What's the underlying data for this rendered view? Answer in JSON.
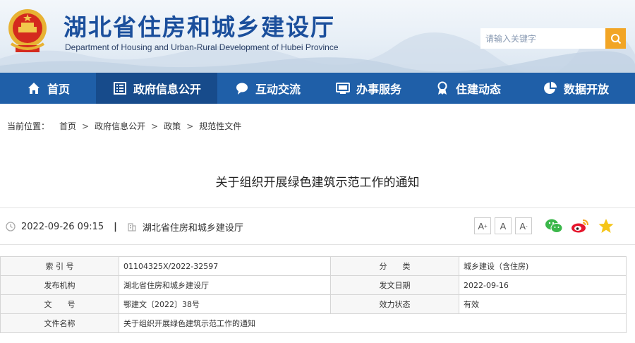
{
  "header": {
    "title": "湖北省住房和城乡建设厅",
    "subtitle": "Department of Housing and Urban-Rural Development of Hubei Province",
    "search": {
      "placeholder": "请输入关键字"
    }
  },
  "nav": {
    "items": [
      {
        "label": "首页",
        "icon": "home-icon"
      },
      {
        "label": "政府信息公开",
        "icon": "document-list-icon"
      },
      {
        "label": "互动交流",
        "icon": "speech-bubble-icon"
      },
      {
        "label": "办事服务",
        "icon": "monitor-icon"
      },
      {
        "label": "住建动态",
        "icon": "award-icon"
      },
      {
        "label": "数据开放",
        "icon": "pie-chart-icon"
      }
    ],
    "active_index": 1
  },
  "breadcrumb": {
    "label": "当前位置：",
    "items": [
      "首页",
      "政府信息公开",
      "政策",
      "规范性文件"
    ],
    "separator": ">"
  },
  "article": {
    "title": "关于组织开展绿色建筑示范工作的通知",
    "datetime": "2022-09-26 09:15",
    "source": "湖北省住房和城乡建设厅",
    "font_buttons": [
      "A+",
      "A",
      "A-"
    ]
  },
  "share": [
    "wechat-icon",
    "weibo-icon",
    "favorite-star-icon"
  ],
  "info_table": {
    "rows": [
      [
        "索 引 号",
        "01104325X/2022-32597",
        "分　　类",
        "城乡建设（含住房)"
      ],
      [
        "发布机构",
        "湖北省住房和城乡建设厅",
        "发文日期",
        "2022-09-16"
      ],
      [
        "文　　号",
        "鄂建文〔2022〕38号",
        "效力状态",
        "有效"
      ],
      [
        "文件名称",
        "关于组织开展绿色建筑示范工作的通知"
      ]
    ]
  },
  "colors": {
    "nav_bg": "#1f5fa8",
    "nav_active": "#174b8b",
    "title_blue": "#1b4f9c",
    "search_button": "#f2a525",
    "label_cell": "#f7f7f7"
  }
}
